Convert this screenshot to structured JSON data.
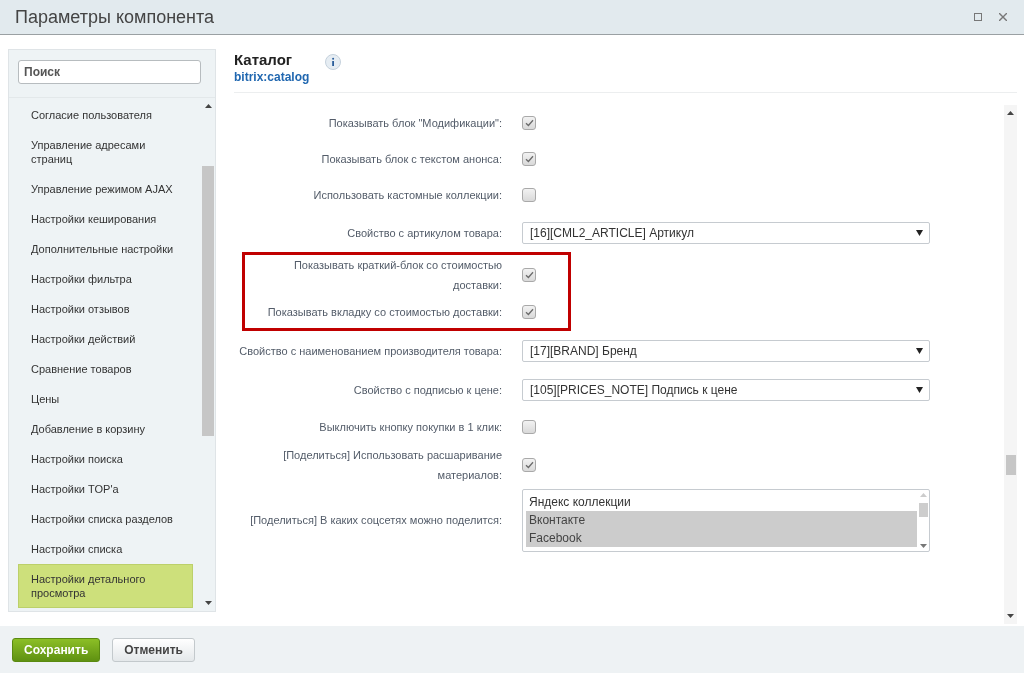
{
  "window": {
    "title": "Параметры компонента"
  },
  "sidebar": {
    "search": {
      "placeholder": "Поиск"
    },
    "items": [
      {
        "label": "Согласие пользователя",
        "selected": false
      },
      {
        "label": "Управление адресами страниц",
        "selected": false
      },
      {
        "label": "Управление режимом AJAX",
        "selected": false
      },
      {
        "label": "Настройки кеширования",
        "selected": false
      },
      {
        "label": "Дополнительные настройки",
        "selected": false
      },
      {
        "label": "Настройки фильтра",
        "selected": false
      },
      {
        "label": "Настройки отзывов",
        "selected": false
      },
      {
        "label": "Настройки действий",
        "selected": false
      },
      {
        "label": "Сравнение товаров",
        "selected": false
      },
      {
        "label": "Цены",
        "selected": false
      },
      {
        "label": "Добавление в корзину",
        "selected": false
      },
      {
        "label": "Настройки поиска",
        "selected": false
      },
      {
        "label": "Настройки TOP'а",
        "selected": false
      },
      {
        "label": "Настройки списка разделов",
        "selected": false
      },
      {
        "label": "Настройки списка",
        "selected": false
      },
      {
        "label": "Настройки детального просмотра",
        "selected": true
      }
    ]
  },
  "component": {
    "title": "Каталог",
    "code": "bitrix:catalog"
  },
  "rows": [
    {
      "kind": "checkbox",
      "label": "Показывать блок \"Модификации\":",
      "checked": true,
      "highlighted": false
    },
    {
      "kind": "checkbox",
      "label": "Показывать блок с текстом анонса:",
      "checked": true,
      "highlighted": false
    },
    {
      "kind": "checkbox",
      "label": "Использовать кастомные коллекции:",
      "checked": false,
      "highlighted": false
    },
    {
      "kind": "select",
      "label": "Свойство с артикулом товара:",
      "value": "[16][CML2_ARTICLE] Артикул",
      "highlighted": false
    },
    {
      "kind": "checkbox",
      "label": "Показывать краткий-блок со стоимостью доставки:",
      "checked": true,
      "highlighted": true
    },
    {
      "kind": "checkbox",
      "label": "Показывать вкладку со стоимостью доставки:",
      "checked": true,
      "highlighted": true
    },
    {
      "kind": "select",
      "label": "Свойство с наименованием производителя товара:",
      "value": "[17][BRAND] Бренд",
      "highlighted": false
    },
    {
      "kind": "select",
      "label": "Свойство с подписью к цене:",
      "value": "[105][PRICES_NOTE] Подпись к цене",
      "highlighted": false
    },
    {
      "kind": "checkbox",
      "label": "Выключить кнопку покупки в 1 клик:",
      "checked": false,
      "highlighted": false
    },
    {
      "kind": "checkbox",
      "label": "[Поделиться] Использовать расшаривание материалов:",
      "checked": true,
      "highlighted": false
    },
    {
      "kind": "listbox",
      "label": "[Поделиться] В каких соцсетях можно поделится:",
      "highlighted": false,
      "options": [
        {
          "label": "Яндекс коллекции",
          "selected": false
        },
        {
          "label": "Вконтакте",
          "selected": true
        },
        {
          "label": "Facebook",
          "selected": true
        }
      ]
    }
  ],
  "buttons": [
    {
      "kind": "primary",
      "label": "Сохранить"
    },
    {
      "kind": "secondary",
      "label": "Отменить"
    }
  ]
}
